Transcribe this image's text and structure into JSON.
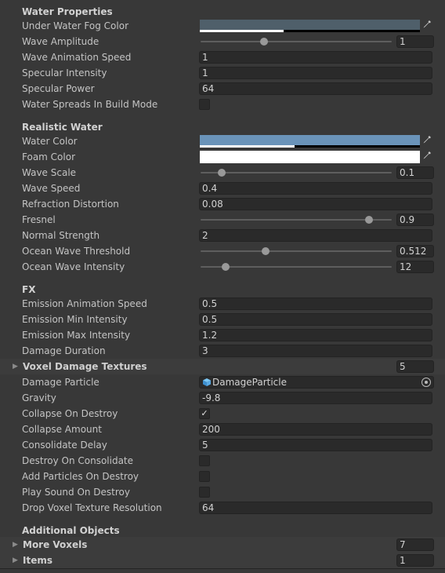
{
  "water_properties": {
    "header": "Water Properties",
    "under_water_fog_color": {
      "label": "Under Water Fog Color",
      "color": "#4f5f6a",
      "alpha": 0.38
    },
    "wave_amplitude": {
      "label": "Wave Amplitude",
      "value": "1",
      "slider_fraction": 0.33
    },
    "wave_animation_speed": {
      "label": "Wave Animation Speed",
      "value": "1"
    },
    "specular_intensity": {
      "label": "Specular Intensity",
      "value": "1"
    },
    "specular_power": {
      "label": "Specular Power",
      "value": "64"
    },
    "water_spreads_in_build_mode": {
      "label": "Water Spreads In Build Mode",
      "checked": false
    }
  },
  "realistic_water": {
    "header": "Realistic Water",
    "water_color": {
      "label": "Water Color",
      "color": "#6a93b9",
      "alpha": 0.43
    },
    "foam_color": {
      "label": "Foam Color",
      "color": "#ffffff",
      "alpha": 1.0
    },
    "wave_scale": {
      "label": "Wave Scale",
      "value": "0.1",
      "slider_fraction": 0.11
    },
    "wave_speed": {
      "label": "Wave Speed",
      "value": "0.4"
    },
    "refraction_distortion": {
      "label": "Refraction Distortion",
      "value": "0.08"
    },
    "fresnel": {
      "label": "Fresnel",
      "value": "0.9",
      "slider_fraction": 0.88
    },
    "normal_strength": {
      "label": "Normal Strength",
      "value": "2"
    },
    "ocean_wave_threshold": {
      "label": "Ocean Wave Threshold",
      "value": "0.512",
      "slider_fraction": 0.34
    },
    "ocean_wave_intensity": {
      "label": "Ocean Wave Intensity",
      "value": "12",
      "slider_fraction": 0.13
    }
  },
  "fx": {
    "header": "FX",
    "emission_animation_speed": {
      "label": "Emission Animation Speed",
      "value": "0.5"
    },
    "emission_min_intensity": {
      "label": "Emission Min Intensity",
      "value": "0.5"
    },
    "emission_max_intensity": {
      "label": "Emission Max Intensity",
      "value": "1.2"
    },
    "damage_duration": {
      "label": "Damage Duration",
      "value": "3"
    },
    "voxel_damage_textures": {
      "label": "Voxel Damage Textures",
      "count": "5"
    },
    "damage_particle": {
      "label": "Damage Particle",
      "value": "DamageParticle"
    },
    "gravity": {
      "label": "Gravity",
      "value": "-9.8"
    },
    "collapse_on_destroy": {
      "label": "Collapse On Destroy",
      "checked": true,
      "check_glyph": "✓"
    },
    "collapse_amount": {
      "label": "Collapse Amount",
      "value": "200"
    },
    "consolidate_delay": {
      "label": "Consolidate Delay",
      "value": "5"
    },
    "destroy_on_consolidate": {
      "label": "Destroy On Consolidate",
      "checked": false
    },
    "add_particles_on_destroy": {
      "label": "Add Particles On Destroy",
      "checked": false
    },
    "play_sound_on_destroy": {
      "label": "Play Sound On Destroy",
      "checked": false
    },
    "drop_voxel_texture_resolution": {
      "label": "Drop Voxel Texture Resolution",
      "value": "64"
    }
  },
  "additional_objects": {
    "header": "Additional Objects",
    "more_voxels": {
      "label": "More Voxels",
      "count": "7"
    },
    "items": {
      "label": "Items",
      "count": "1"
    }
  },
  "icons": {
    "fold_arrow": "▶",
    "eyedropper": "eyedropper-icon",
    "object_picker": "target-icon",
    "prefab": "cube-icon"
  }
}
